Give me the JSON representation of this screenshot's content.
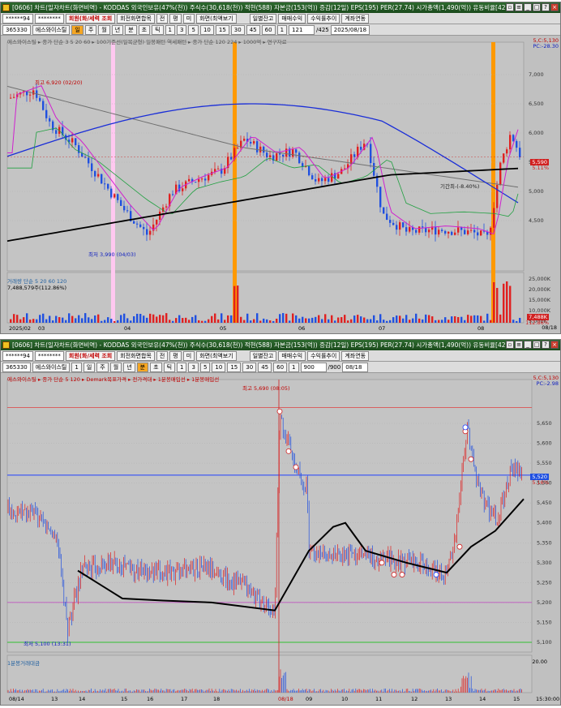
{
  "top": {
    "title": "[0606] 차트(일자차트(화면비역) - KODDAS 외국인보유(47%(천)) 주식수(30,618(천)) 적현(588) 자본금(153(억)) 증감(12일) EPS(195) PER(27.74) 시가총액(1,490(억)) 유동비율[42.0]",
    "toolbar1": [
      "******94",
      "********",
      "회원(화/세력 조회",
      "회전화면합목",
      "전",
      "평",
      "미",
      "화면(최액보기",
      "일별잔고",
      "매매수익",
      "수익률추이",
      "계좌연동"
    ],
    "toolbar2": [
      "365330",
      "에스와이스틸",
      "일",
      "주",
      "월",
      "년",
      "분",
      "초",
      "틱",
      "1",
      "3",
      "5",
      "10",
      "15",
      "30",
      "45",
      "60",
      "1",
      "121",
      "/425",
      "2025/08/18"
    ],
    "legend": "에스와이스틸 ▸ 종가 단순 3  5  20  60  ▸ 100기준선(일목균형) 일봉패턴 역세패턴 ▸ 종가 단순 120 224 ▸ 1000억 ▸ 연구자료",
    "price_ticks": [
      "7,000",
      "6,500",
      "6,000",
      "5,500",
      "5,000",
      "4,500"
    ],
    "current_price": "5,590",
    "current_pct": "5.11%",
    "top_right_high": "5,C:5,130",
    "top_right_pc": "PC:-28.30",
    "annot_high": "최고 6,920 (02/20)",
    "annot_low": "최저 3,990 (04/03)",
    "annot_mid": "기간최-(-8.40%)",
    "volume_legend": "거래량 단순 5  20  60  120",
    "volume_value": "7,488,579주(112.86%)",
    "volume_ticks": [
      "25,000K",
      "20,000K",
      "15,000K",
      "10,000K",
      "5,000K"
    ],
    "volume_current": "7,488K",
    "volume_current2": "112.86%",
    "dates": [
      "2025/02",
      "03",
      "04",
      "05",
      "06",
      "07",
      "08"
    ],
    "bottom_right": "08/18"
  },
  "bottom": {
    "title": "[0606] 차트(일자차트(화면비역) - KODDAS 외국인보유(47%(천)) 주식수(30,618(천)) 적현(588) 자본금(153(억)) 증감(12일) EPS(195) PER(27.74) 시가총액(1,490(억)) 유동비율[42.0]",
    "toolbar1": [
      "******94",
      "********",
      "회원(화/세력 조회",
      "회전화면합목",
      "전",
      "평",
      "미",
      "화면(최액보기",
      "일별잔고",
      "매매수익",
      "수익률추이",
      "계좌연동"
    ],
    "toolbar2": [
      "365330",
      "에스와이스틸",
      "1",
      "일",
      "주",
      "월",
      "년",
      "분",
      "초",
      "틱",
      "1",
      "3",
      "5",
      "10",
      "15",
      "30",
      "45",
      "60",
      "1",
      "900",
      "/900",
      "08/18"
    ],
    "legend": "에스와이스틸 ▸ 종가 단순 5 120 ▸ Demark목표가격 ▸ 전가격대 ▸ 1분봉매입선 ▸ 1분봉매입선",
    "price_ticks": [
      "5,650",
      "5,600",
      "5,550",
      "5,500",
      "5,450",
      "5,400",
      "5,350",
      "5,300",
      "5,250",
      "5,200",
      "5,150",
      "5,100"
    ],
    "current_price": "5,520",
    "current_pct": "5.16%",
    "top_right_high": "5,C:5,130",
    "top_right_pc": "PC:-2.98",
    "annot_high": "최고 5,690 (08:05)",
    "annot_low": "최저 5,100 (13:31)",
    "volume_legend": "1분봉거래대금",
    "volume_tick": "20.00",
    "dates": [
      "08/14",
      "13",
      "14",
      "15",
      "16",
      "17",
      "18",
      "08/18",
      "09",
      "10",
      "11",
      "12",
      "13",
      "14",
      "15",
      "15:30:00"
    ]
  },
  "colors": {
    "title_bg": "#1b4a1c",
    "chart_bg": "#c0c0c0",
    "up": "#e02020",
    "down": "#2050e0",
    "ma_black": "#000000",
    "ma_blue": "#1a2ed8",
    "ma_gray": "#707070",
    "ma_magenta": "#d020d0",
    "ma_green": "#20a040",
    "orange_band": "#ff9900",
    "pink_band": "#ffc8f0"
  }
}
